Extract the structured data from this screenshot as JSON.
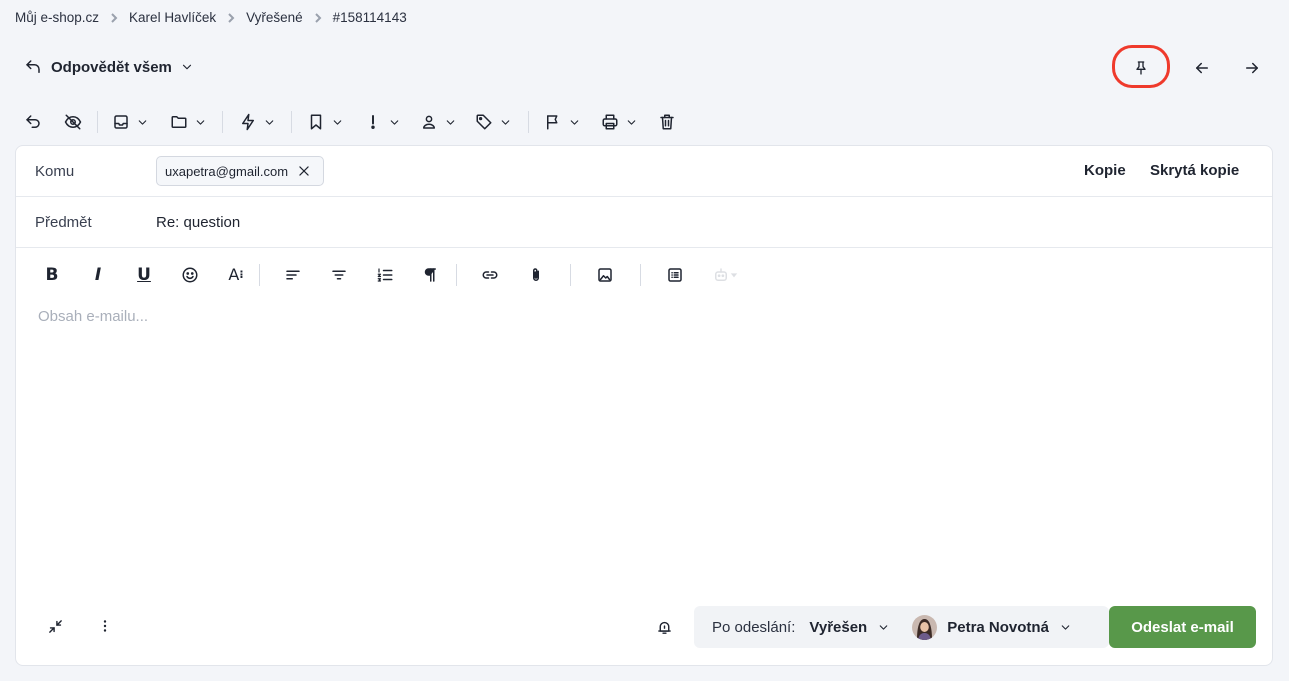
{
  "breadcrumb": [
    "Můj e-shop.cz",
    "Karel Havlíček",
    "Vyřešené",
    "#158114143"
  ],
  "header": {
    "reply_mode": "Odpovědět všem",
    "pin_icon": "pin-icon",
    "prev_icon": "arrow-left-icon",
    "next_icon": "arrow-right-icon",
    "highlight_color": "#ef3a2c"
  },
  "toolbar": {
    "icons": [
      "undo-icon",
      "eye-off-icon",
      "inbox-icon",
      "folder-icon",
      "lightning-icon",
      "bookmark-icon",
      "priority-icon",
      "user-icon",
      "tag-icon",
      "flag-icon",
      "printer-icon",
      "trash-icon"
    ]
  },
  "compose": {
    "to_label": "Komu",
    "recipient": "uxapetra@gmail.com",
    "cc_label": "Kopie",
    "bcc_label": "Skrytá kopie",
    "subject_label": "Předmět",
    "subject": "Re: question",
    "body_placeholder": "Obsah e-mailu..."
  },
  "editor": {
    "bold": "B",
    "italic": "I",
    "underline": "U",
    "font_size": "A"
  },
  "footer": {
    "after_send_label": "Po odeslání:",
    "after_send_value": "Vyřešen",
    "agent_name": "Petra Novotná",
    "send_label": "Odeslat e-mail",
    "send_color": "#58984a"
  }
}
